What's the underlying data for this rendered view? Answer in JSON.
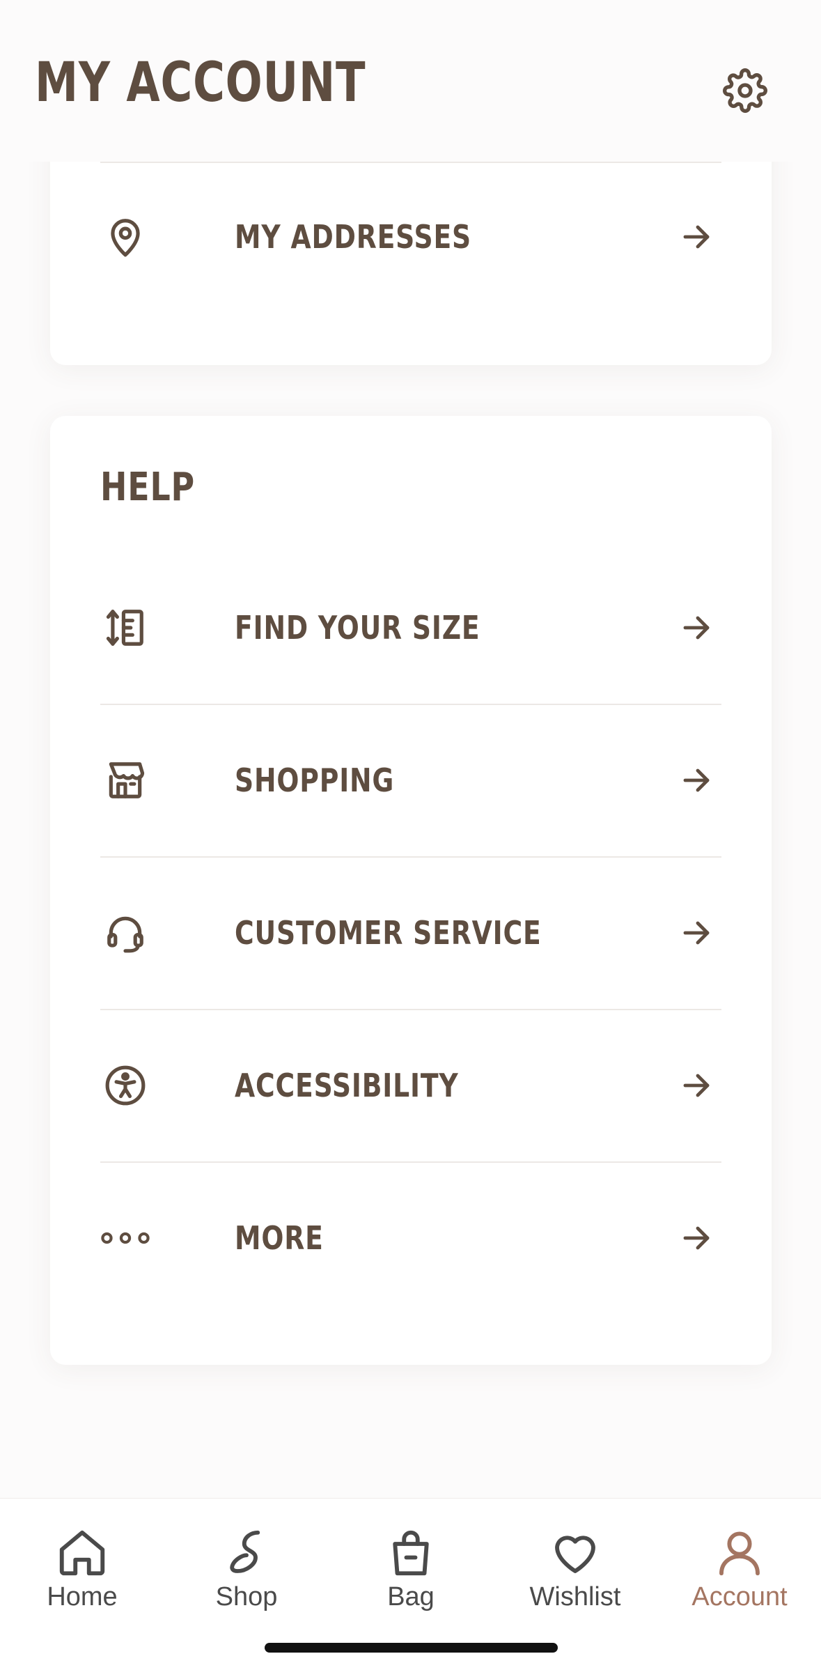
{
  "header": {
    "title": "MY ACCOUNT",
    "settings_icon": "gear-icon"
  },
  "addresses_card": {
    "items": [
      {
        "label": "MY ADDRESSES",
        "icon": "map-pin-icon"
      }
    ]
  },
  "help_card": {
    "title": "HELP",
    "items": [
      {
        "label": "FIND YOUR SIZE",
        "icon": "size-ruler-icon"
      },
      {
        "label": "SHOPPING",
        "icon": "store-icon"
      },
      {
        "label": "CUSTOMER SERVICE",
        "icon": "headset-icon"
      },
      {
        "label": "ACCESSIBILITY",
        "icon": "accessibility-icon"
      },
      {
        "label": "MORE",
        "icon": "more-dots-icon"
      }
    ]
  },
  "tabbar": {
    "active": "Account",
    "tabs": [
      {
        "label": "Home",
        "icon": "home-icon"
      },
      {
        "label": "Shop",
        "icon": "shop-icon"
      },
      {
        "label": "Bag",
        "icon": "bag-icon"
      },
      {
        "label": "Wishlist",
        "icon": "heart-icon"
      },
      {
        "label": "Account",
        "icon": "user-icon"
      }
    ]
  },
  "colors": {
    "text": "#5e4d40",
    "accent": "#a47561",
    "tab_text": "#4a4a4a",
    "divider": "#ece8e5",
    "background": "#fcfbfb",
    "card": "#ffffff"
  }
}
